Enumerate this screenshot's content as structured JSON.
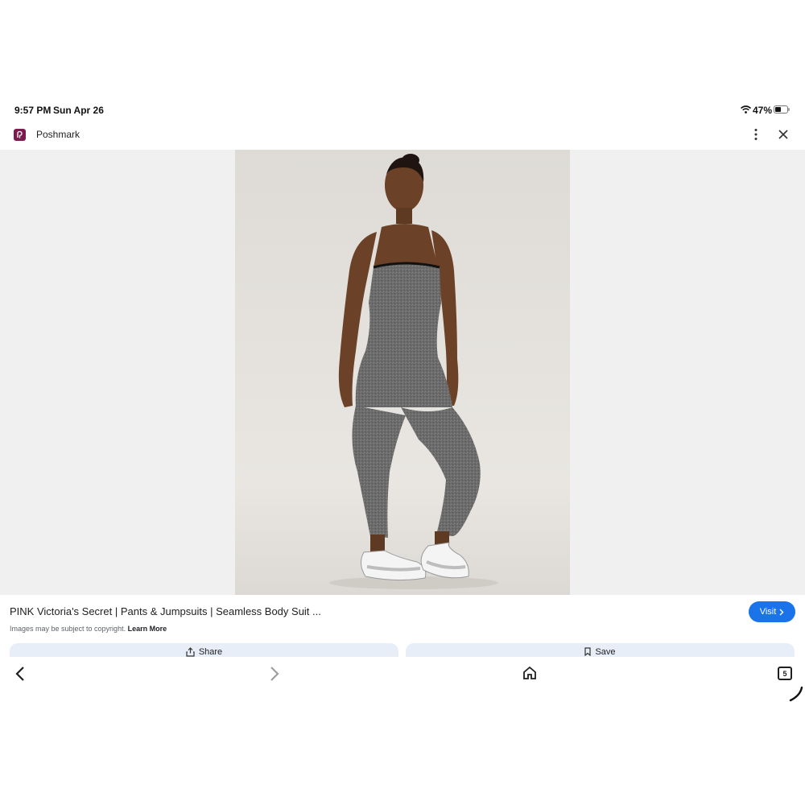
{
  "status_bar": {
    "time": "9:57 PM",
    "date": "Sun Apr 26",
    "battery": "47%"
  },
  "header": {
    "source": "Poshmark",
    "icons": [
      "more-vert-icon",
      "close-icon"
    ]
  },
  "image": {
    "subject": "gray seamless body suit with white sneakers"
  },
  "result": {
    "title": "PINK Victoria's Secret | Pants & Jumpsuits | Seamless Body Suit ...",
    "visit_label": "Visit",
    "copyright": "Images may be subject to copyright.",
    "learn_more": "Learn More"
  },
  "actions": {
    "share_label": "Share",
    "save_label": "Save"
  },
  "nav": {
    "tab_count": "5",
    "icons": [
      "back-icon",
      "forward-icon",
      "home-icon",
      "tabs-icon"
    ]
  },
  "colors": {
    "accent": "#1a73e8",
    "button_bg": "#e8eef7",
    "viewer_bg": "#f0f0f1",
    "favicon": "#7b1b4e"
  }
}
